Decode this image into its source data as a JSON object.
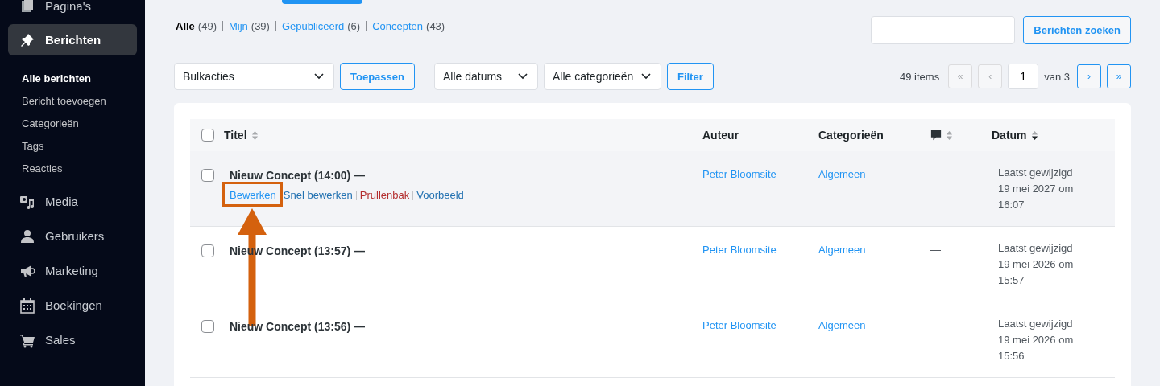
{
  "sidebar": {
    "items": [
      {
        "label": "Pagina's",
        "selected": false
      },
      {
        "label": "Berichten",
        "selected": true,
        "children": [
          {
            "label": "Alle berichten",
            "selected": true
          },
          {
            "label": "Bericht toevoegen",
            "selected": false
          },
          {
            "label": "Categorieën",
            "selected": false
          },
          {
            "label": "Tags",
            "selected": false
          },
          {
            "label": "Reacties",
            "selected": false
          }
        ]
      },
      {
        "label": "Media",
        "selected": false
      },
      {
        "label": "Gebruikers",
        "selected": false
      },
      {
        "label": "Marketing",
        "selected": false
      },
      {
        "label": "Boekingen",
        "selected": false
      },
      {
        "label": "Sales",
        "selected": false
      }
    ]
  },
  "views": [
    {
      "label": "Alle",
      "count": "(49)",
      "selected": true
    },
    {
      "label": "Mijn",
      "count": "(39)",
      "selected": false
    },
    {
      "label": "Gepubliceerd",
      "count": "(6)",
      "selected": false
    },
    {
      "label": "Concepten",
      "count": "(43)",
      "selected": false
    }
  ],
  "search": {
    "button": "Berichten zoeken"
  },
  "bulk_actions": {
    "select": "Bulkacties",
    "button": "Toepassen"
  },
  "filters": {
    "selects": [
      "Alle datums",
      "Alle categorieën"
    ],
    "button": "Filter"
  },
  "pagination": {
    "count": "49 items",
    "page": "1",
    "total": "van 3",
    "before": [
      {
        "label": "«",
        "disabled": true
      },
      {
        "label": "‹",
        "disabled": true
      }
    ],
    "after": [
      {
        "label": "›",
        "disabled": false
      },
      {
        "label": "»",
        "disabled": false
      }
    ]
  },
  "table": {
    "select_all": {
      "checked": false
    },
    "columns": [
      {
        "kind": "text",
        "label": "Titel",
        "sortable": true,
        "sorted": false
      },
      {
        "kind": "text",
        "label": "Auteur"
      },
      {
        "kind": "text",
        "label": "Categorieën"
      },
      {
        "kind": "comments",
        "sortable": true,
        "sorted": false
      },
      {
        "kind": "text",
        "label": "Datum",
        "sortable": true,
        "sorted": true
      }
    ],
    "rows": [
      {
        "checked": false,
        "hovered": true,
        "title": "Nieuw Concept (14:00) —",
        "actions": [
          {
            "label": "Bewerken",
            "kind": "link"
          },
          {
            "label": "Snel bewerken",
            "kind": "link"
          },
          {
            "label": "Prullenbak",
            "kind": "danger"
          },
          {
            "label": "Voorbeeld",
            "kind": "link"
          }
        ],
        "author": "Peter Bloomsite",
        "category": "Algemeen",
        "comments": "—",
        "date": "Laatst gewijzigd 19 mei 2027 om 16:07"
      },
      {
        "checked": false,
        "hovered": false,
        "title": "Nieuw Concept (13:57) —",
        "author": "Peter Bloomsite",
        "category": "Algemeen",
        "comments": "—",
        "date": "Laatst gewijzigd 19 mei 2026 om 15:57"
      },
      {
        "checked": false,
        "hovered": false,
        "title": "Nieuw Concept (13:56) —",
        "author": "Peter Bloomsite",
        "category": "Algemeen",
        "comments": "—",
        "date": "Laatst gewijzigd 19 mei 2026 om 15:56"
      }
    ]
  }
}
